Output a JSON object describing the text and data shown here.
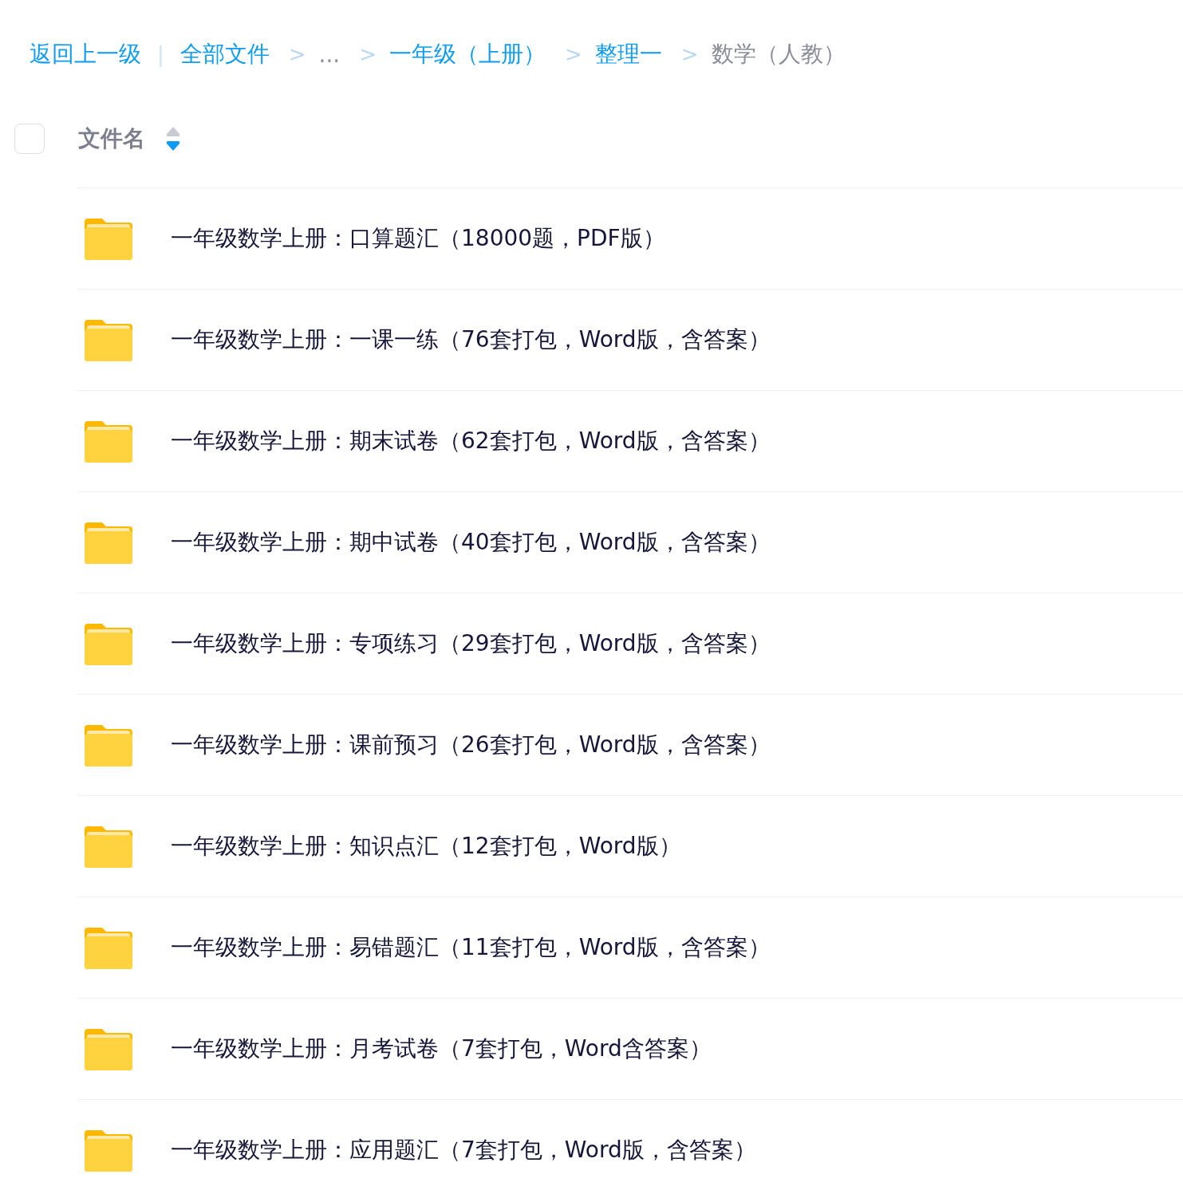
{
  "breadcrumb": {
    "back": "返回上一级",
    "divider": "|",
    "items": [
      {
        "label": "全部文件",
        "link": true
      },
      {
        "label": "...",
        "sep": ">",
        "link": false
      },
      {
        "label": "一年级（上册）",
        "sep": ">",
        "link": true
      },
      {
        "label": "整理一",
        "sep": ">",
        "link": true
      },
      {
        "label": "数学（人教）",
        "sep": ">",
        "link": false
      }
    ]
  },
  "header": {
    "checked": false,
    "column": "文件名",
    "sorted_descending": true
  },
  "files": [
    {
      "kind": "folder",
      "name": "一年级数学上册：口算题汇（18000题，PDF版）"
    },
    {
      "kind": "folder",
      "name": "一年级数学上册：一课一练（76套打包，Word版，含答案）"
    },
    {
      "kind": "folder",
      "name": "一年级数学上册：期末试卷（62套打包，Word版，含答案）"
    },
    {
      "kind": "folder",
      "name": "一年级数学上册：期中试卷（40套打包，Word版，含答案）"
    },
    {
      "kind": "folder",
      "name": "一年级数学上册：专项练习（29套打包，Word版，含答案）"
    },
    {
      "kind": "folder",
      "name": "一年级数学上册：课前预习（26套打包，Word版，含答案）"
    },
    {
      "kind": "folder",
      "name": "一年级数学上册：知识点汇（12套打包，Word版）"
    },
    {
      "kind": "folder",
      "name": "一年级数学上册：易错题汇（11套打包，Word版，含答案）"
    },
    {
      "kind": "folder",
      "name": "一年级数学上册：月考试卷（7套打包，Word含答案）"
    },
    {
      "kind": "folder",
      "name": "一年级数学上册：应用题汇（7套打包，Word版，含答案）"
    }
  ]
}
